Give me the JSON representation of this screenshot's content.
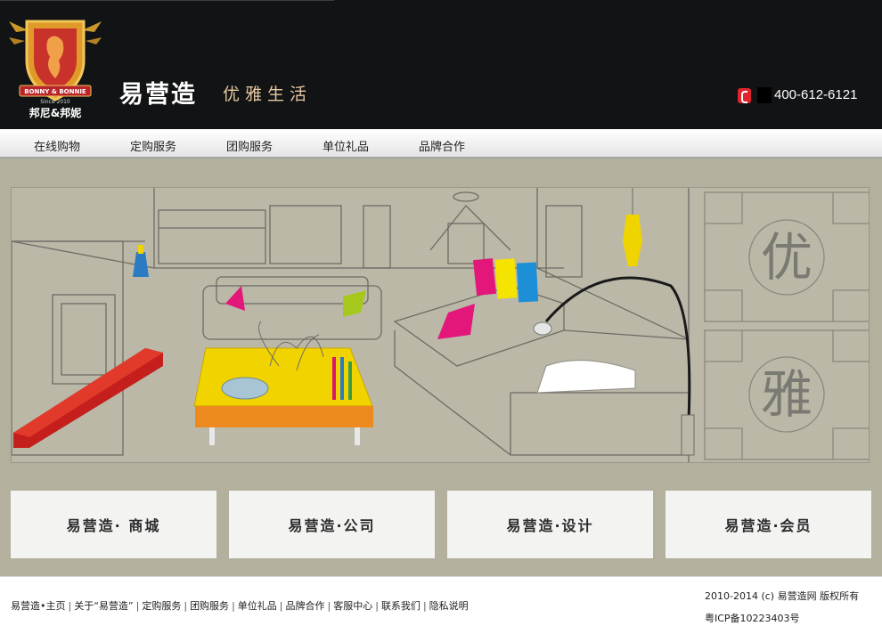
{
  "header": {
    "logo_text": "邦尼&邦妮",
    "logo_ribbon": "BONNY & BONNIE",
    "logo_since": "Since 2010",
    "brand": "易营造",
    "tagline": "优雅生活",
    "phone": "400-612-6121",
    "phone_icon": "phone-icon"
  },
  "nav": {
    "items": [
      {
        "label": "在线购物"
      },
      {
        "label": "定购服务"
      },
      {
        "label": "团购服务"
      },
      {
        "label": "单位礼品"
      },
      {
        "label": "品牌合作"
      }
    ]
  },
  "banner": {
    "screen_chars": [
      "优",
      "雅"
    ]
  },
  "tiles": [
    {
      "label": "易营造· 商城"
    },
    {
      "label": "易营造·公司"
    },
    {
      "label": "易营造·设计"
    },
    {
      "label": "易营造·会员"
    }
  ],
  "footer": {
    "links": [
      "易营造•主页",
      "关于“易营造”",
      "定购服务",
      "团购服务",
      "单位礼品",
      "品牌合作",
      "客服中心",
      "联系我们",
      "隐私说明"
    ],
    "copyright": "2010-2014 (c) 易营造网 版权所有",
    "icp": "粤ICP备10223403号"
  },
  "colors": {
    "header_bg": "#111314",
    "page_bg": "#b3b09d",
    "tagline": "#e7c9a2",
    "accent_red": "#e0242d"
  }
}
